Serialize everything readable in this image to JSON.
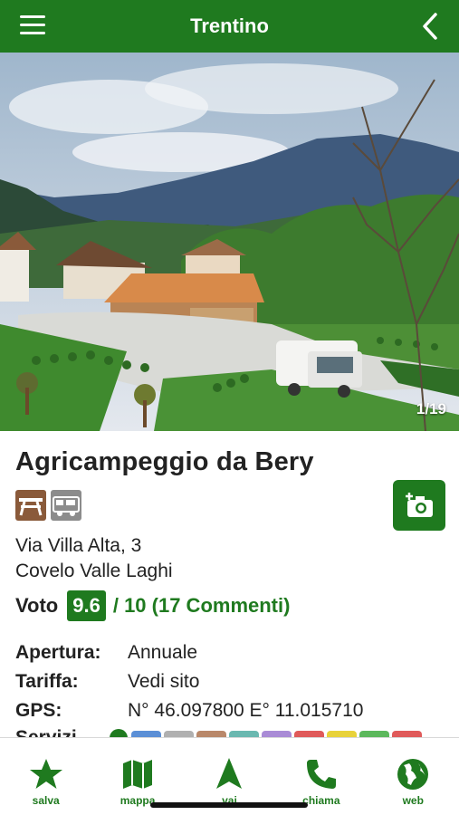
{
  "header": {
    "title": "Trentino",
    "menu_icon": "hamburger-menu-icon",
    "back_icon": "chevron-left-icon"
  },
  "gallery": {
    "counter": "1/19"
  },
  "place": {
    "name": "Agricampeggio da Bery",
    "category_icons": [
      "picnic-table-icon",
      "camper-area-icon"
    ],
    "address_line1": "Via Villa Alta, 3",
    "address_line2": "Covelo Valle Laghi",
    "add_photo_icon": "add-photo-camera-icon"
  },
  "rating": {
    "label": "Voto",
    "score": "9.6",
    "rest": "/ 10 (17 Commenti)"
  },
  "details": {
    "opening_label": "Apertura:",
    "opening_value": "Annuale",
    "rate_label": "Tariffa:",
    "rate_value": "Vedi sito",
    "gps_label": "GPS:",
    "gps_value": "N° 46.097800 E° 11.015710",
    "services_label": "Servizi"
  },
  "service_colors": [
    "#5b8fd6",
    "#b0b0b0",
    "#b9886a",
    "#6ab8b0",
    "#a98bd6",
    "#e05a5a",
    "#e8d23a",
    "#5cb85c",
    "#e05a5a"
  ],
  "bottom_nav": [
    {
      "label": "salva",
      "icon": "star-icon"
    },
    {
      "label": "mappa",
      "icon": "map-icon"
    },
    {
      "label": "vai",
      "icon": "navigation-arrow-icon"
    },
    {
      "label": "chiama",
      "icon": "phone-icon"
    },
    {
      "label": "web",
      "icon": "globe-icon"
    }
  ],
  "colors": {
    "brand_green": "#1f7a1f",
    "text_dark": "#222222"
  }
}
